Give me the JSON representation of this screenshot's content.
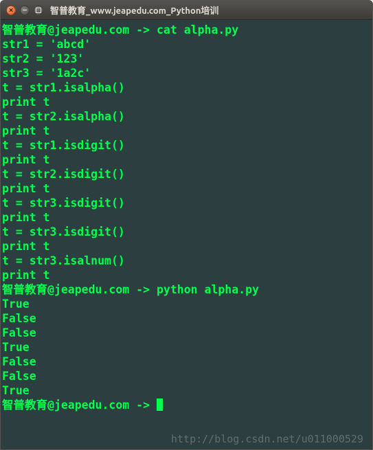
{
  "window": {
    "title": "智普教育_www.jeapedu.com_Python培训"
  },
  "prompt": {
    "user": "智普教育",
    "host": "jeapedu.com",
    "separator": " -> "
  },
  "commands": {
    "cat": "cat alpha.py",
    "run": "python alpha.py"
  },
  "source": {
    "l1": "str1 = 'abcd'",
    "l2": "str2 = '123'",
    "l3": "str3 = '1a2c'",
    "l4": "t = str1.isalpha()",
    "l5": "print t",
    "l6": "t = str2.isalpha()",
    "l7": "print t",
    "l8": "t = str1.isdigit()",
    "l9": "print t",
    "l10": "t = str2.isdigit()",
    "l11": "print t",
    "l12": "t = str3.isdigit()",
    "l13": "print t",
    "l14": "t = str3.isdigit()",
    "l15": "print t",
    "l16": "t = str3.isalnum()",
    "l17": "print t"
  },
  "output": {
    "o1": "True",
    "o2": "False",
    "o3": "False",
    "o4": "True",
    "o5": "False",
    "o6": "False",
    "o7": "True"
  },
  "watermark": "http://blog.csdn.net/u011000529"
}
